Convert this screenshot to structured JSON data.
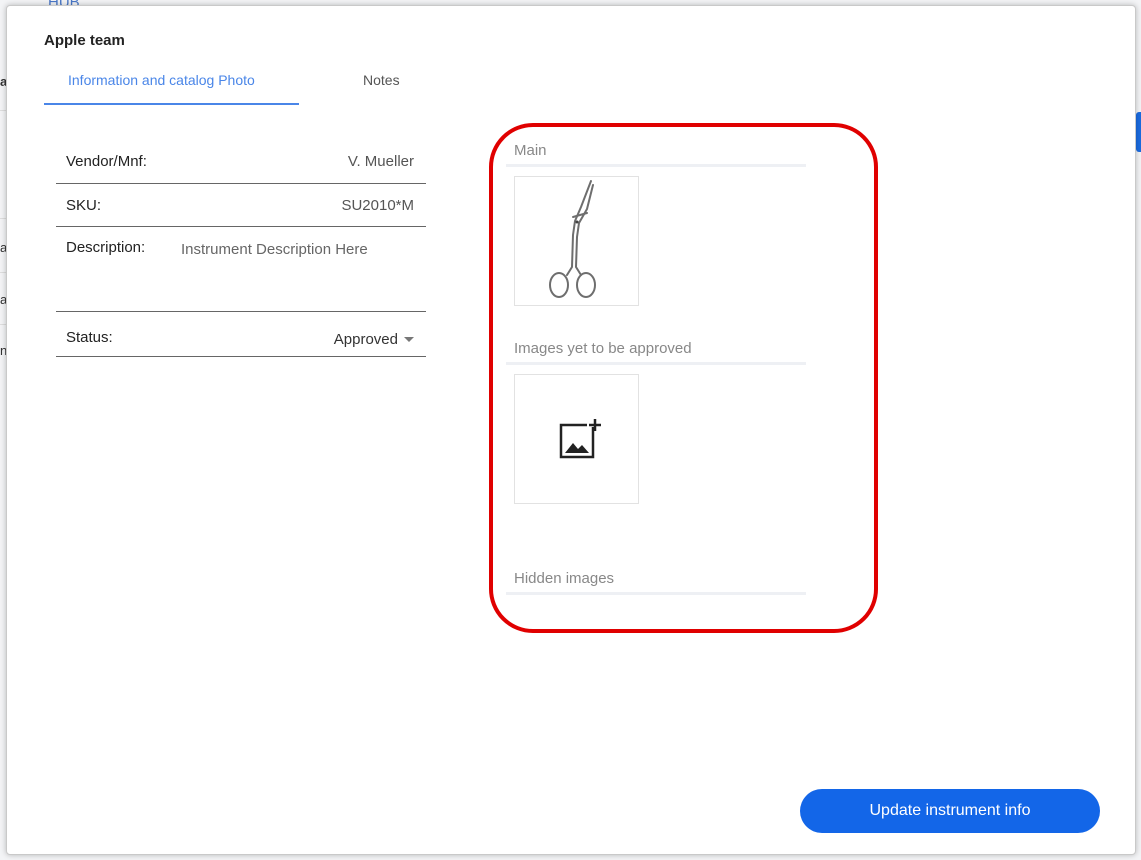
{
  "background": {
    "hub_label": "HUB",
    "fragment_char": "a",
    "fragment_char_2": "n"
  },
  "modal": {
    "title": "Apple team",
    "tabs": [
      {
        "label": "Information and catalog Photo",
        "active": true
      },
      {
        "label": "Notes",
        "active": false
      }
    ],
    "fields": {
      "vendor": {
        "label": "Vendor/Mnf:",
        "value": "V. Mueller"
      },
      "sku": {
        "label": "SKU:",
        "value": "SU2010*M"
      },
      "description": {
        "label": "Description:",
        "value": "Instrument Description Here"
      },
      "status": {
        "label": "Status:",
        "value": "Approved"
      }
    },
    "images": {
      "main": {
        "label": "Main",
        "thumbnail_icon": "scissors-icon"
      },
      "pending": {
        "label": "Images yet to be approved",
        "thumbnail_icon": "add-image-icon"
      },
      "hidden": {
        "label": "Hidden images"
      }
    },
    "update_button_label": "Update instrument info"
  },
  "colors": {
    "accent": "#4a86e8",
    "button": "#1366e8",
    "highlight": "#e00000"
  }
}
